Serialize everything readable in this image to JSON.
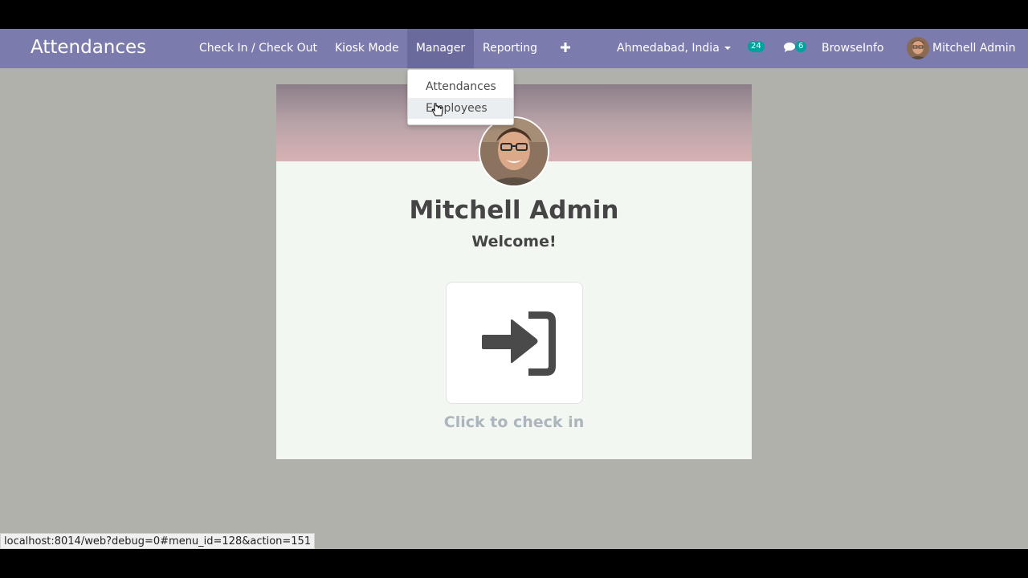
{
  "navbar": {
    "app_title": "Attendances",
    "menu": {
      "check_in_out": "Check In / Check Out",
      "kiosk_mode": "Kiosk Mode",
      "manager": "Manager",
      "reporting": "Reporting",
      "add_icon": "plus-icon"
    },
    "company": "Ahmedabad, India",
    "activity_count": "24",
    "messages_count": "6",
    "company_name": "BrowseInfo",
    "user_name": "Mitchell Admin"
  },
  "manager_dropdown": {
    "items": [
      "Attendances",
      "Employees"
    ],
    "hovered": "Employees"
  },
  "employee_card": {
    "name": "Mitchell Admin",
    "greeting": "Welcome!",
    "action_label": "Click to check in",
    "action_icon": "sign-in-icon"
  },
  "status_bar": {
    "url": "localhost:8014/web?debug=0#menu_id=128&action=151"
  },
  "colors": {
    "navbar": "#7c7bad",
    "badge": "#00a09d",
    "backdrop": "#b1b1ab"
  }
}
